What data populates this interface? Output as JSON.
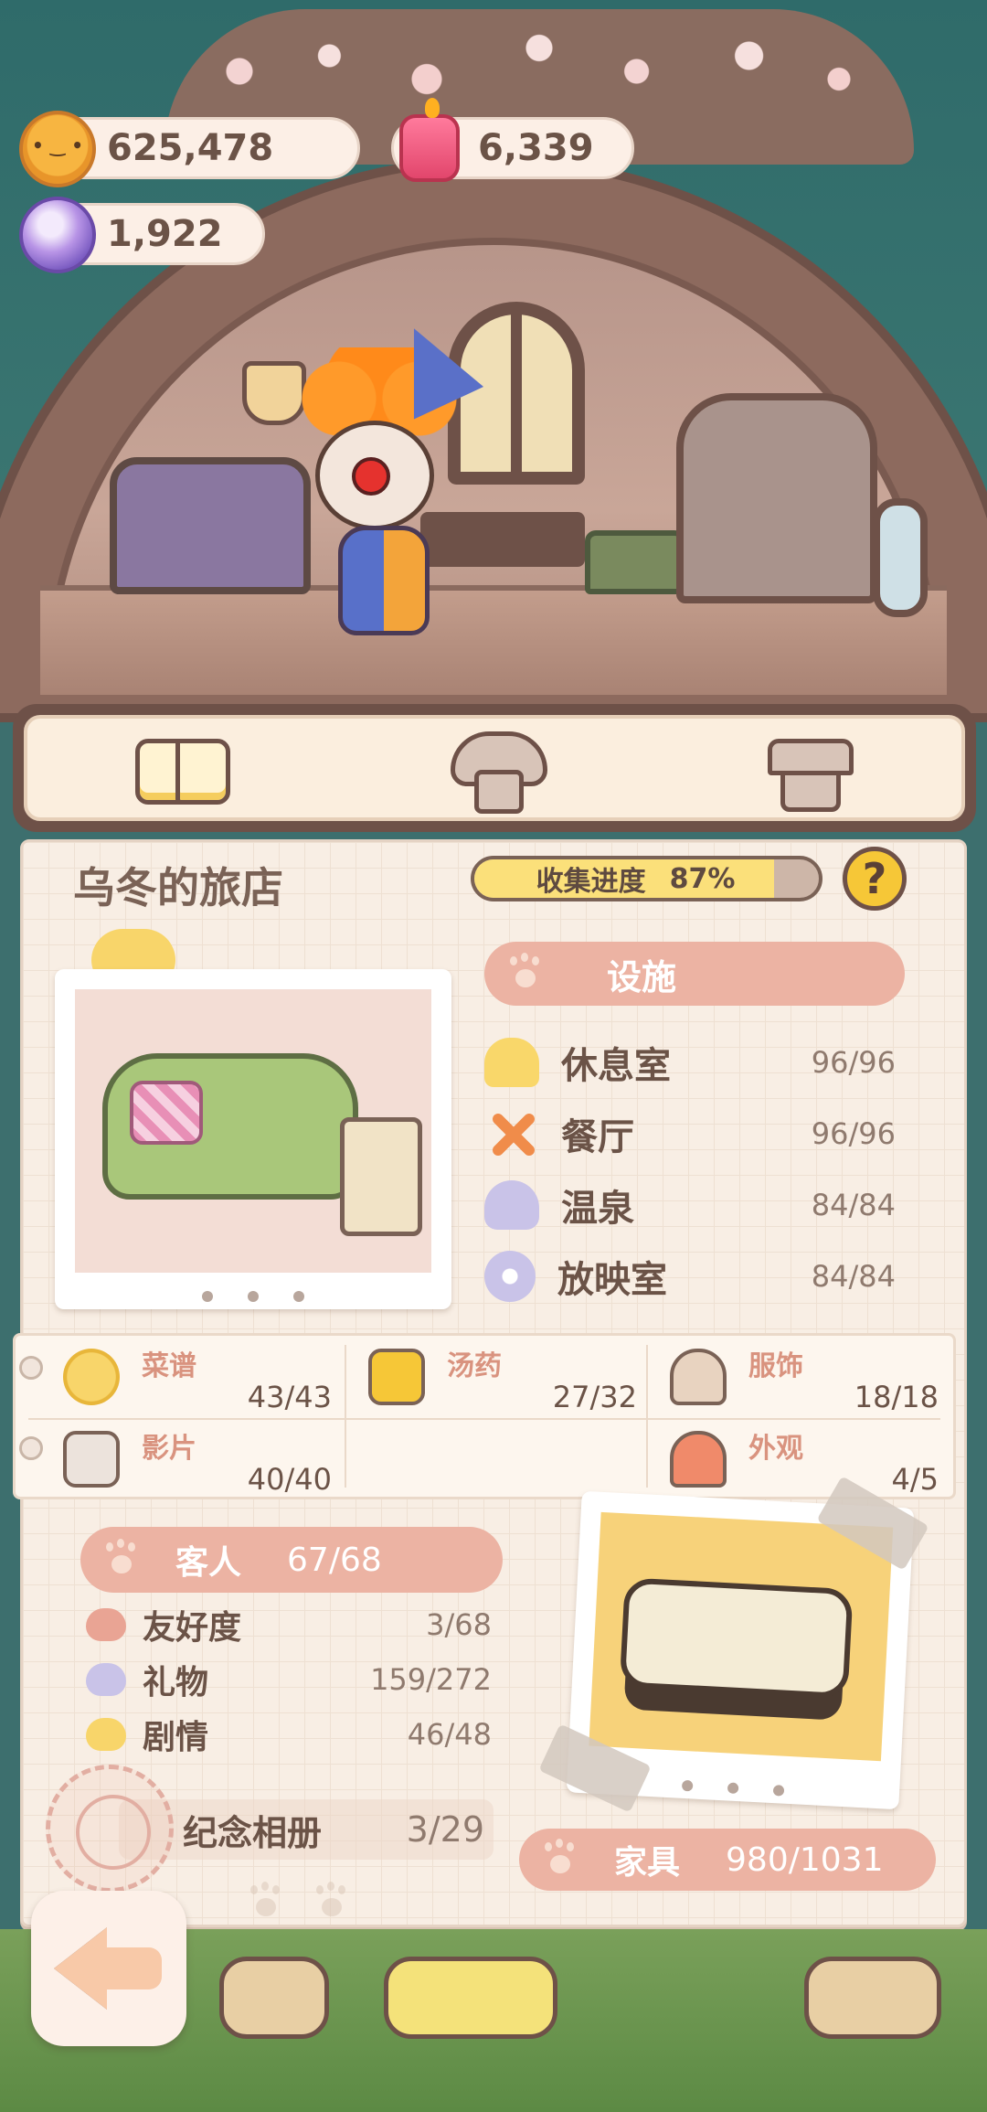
{
  "currency": {
    "cookies": "625,478",
    "candles": "6,339",
    "gems": "1,922"
  },
  "tabs": {
    "book_icon": "book-icon",
    "hotel_icon": "hotel-icon",
    "shirt_icon": "shirt-icon",
    "active": "book"
  },
  "panel": {
    "title": "乌冬的旅店",
    "progress_label": "收集进度",
    "progress_value": "87%",
    "progress_fraction": 0.87,
    "help_label": "?"
  },
  "facilities": {
    "header": "设施",
    "items": [
      {
        "name": "休息室",
        "count": "96/96",
        "icon": "lounge-icon"
      },
      {
        "name": "餐厅",
        "count": "96/96",
        "icon": "dining-icon"
      },
      {
        "name": "温泉",
        "count": "84/84",
        "icon": "hot-spring-icon"
      },
      {
        "name": "放映室",
        "count": "84/84",
        "icon": "cinema-icon"
      }
    ]
  },
  "collections": {
    "recipes": {
      "name": "菜谱",
      "count": "43/43"
    },
    "potions": {
      "name": "汤药",
      "count": "27/32"
    },
    "outfits": {
      "name": "服饰",
      "count": "18/18"
    },
    "films": {
      "name": "影片",
      "count": "40/40"
    },
    "exterior": {
      "name": "外观",
      "count": "4/5"
    }
  },
  "guests": {
    "label": "客人",
    "count": "67/68",
    "stats": [
      {
        "name": "友好度",
        "value": "3/68",
        "color": "#e9a494"
      },
      {
        "name": "礼物",
        "value": "159/272",
        "color": "#c9c3e8"
      },
      {
        "name": "剧情",
        "value": "46/48",
        "color": "#f8d56a"
      }
    ]
  },
  "album": {
    "label": "纪念相册",
    "count": "3/29"
  },
  "furniture": {
    "label": "家具",
    "count": "980/1031"
  },
  "colors": {
    "accent_pink": "#ecb3a3",
    "panel_bg": "#f8eee4",
    "text_brown": "#6b5347",
    "progress_fill": "#fbe07a",
    "help_yellow": "#f6c737"
  }
}
